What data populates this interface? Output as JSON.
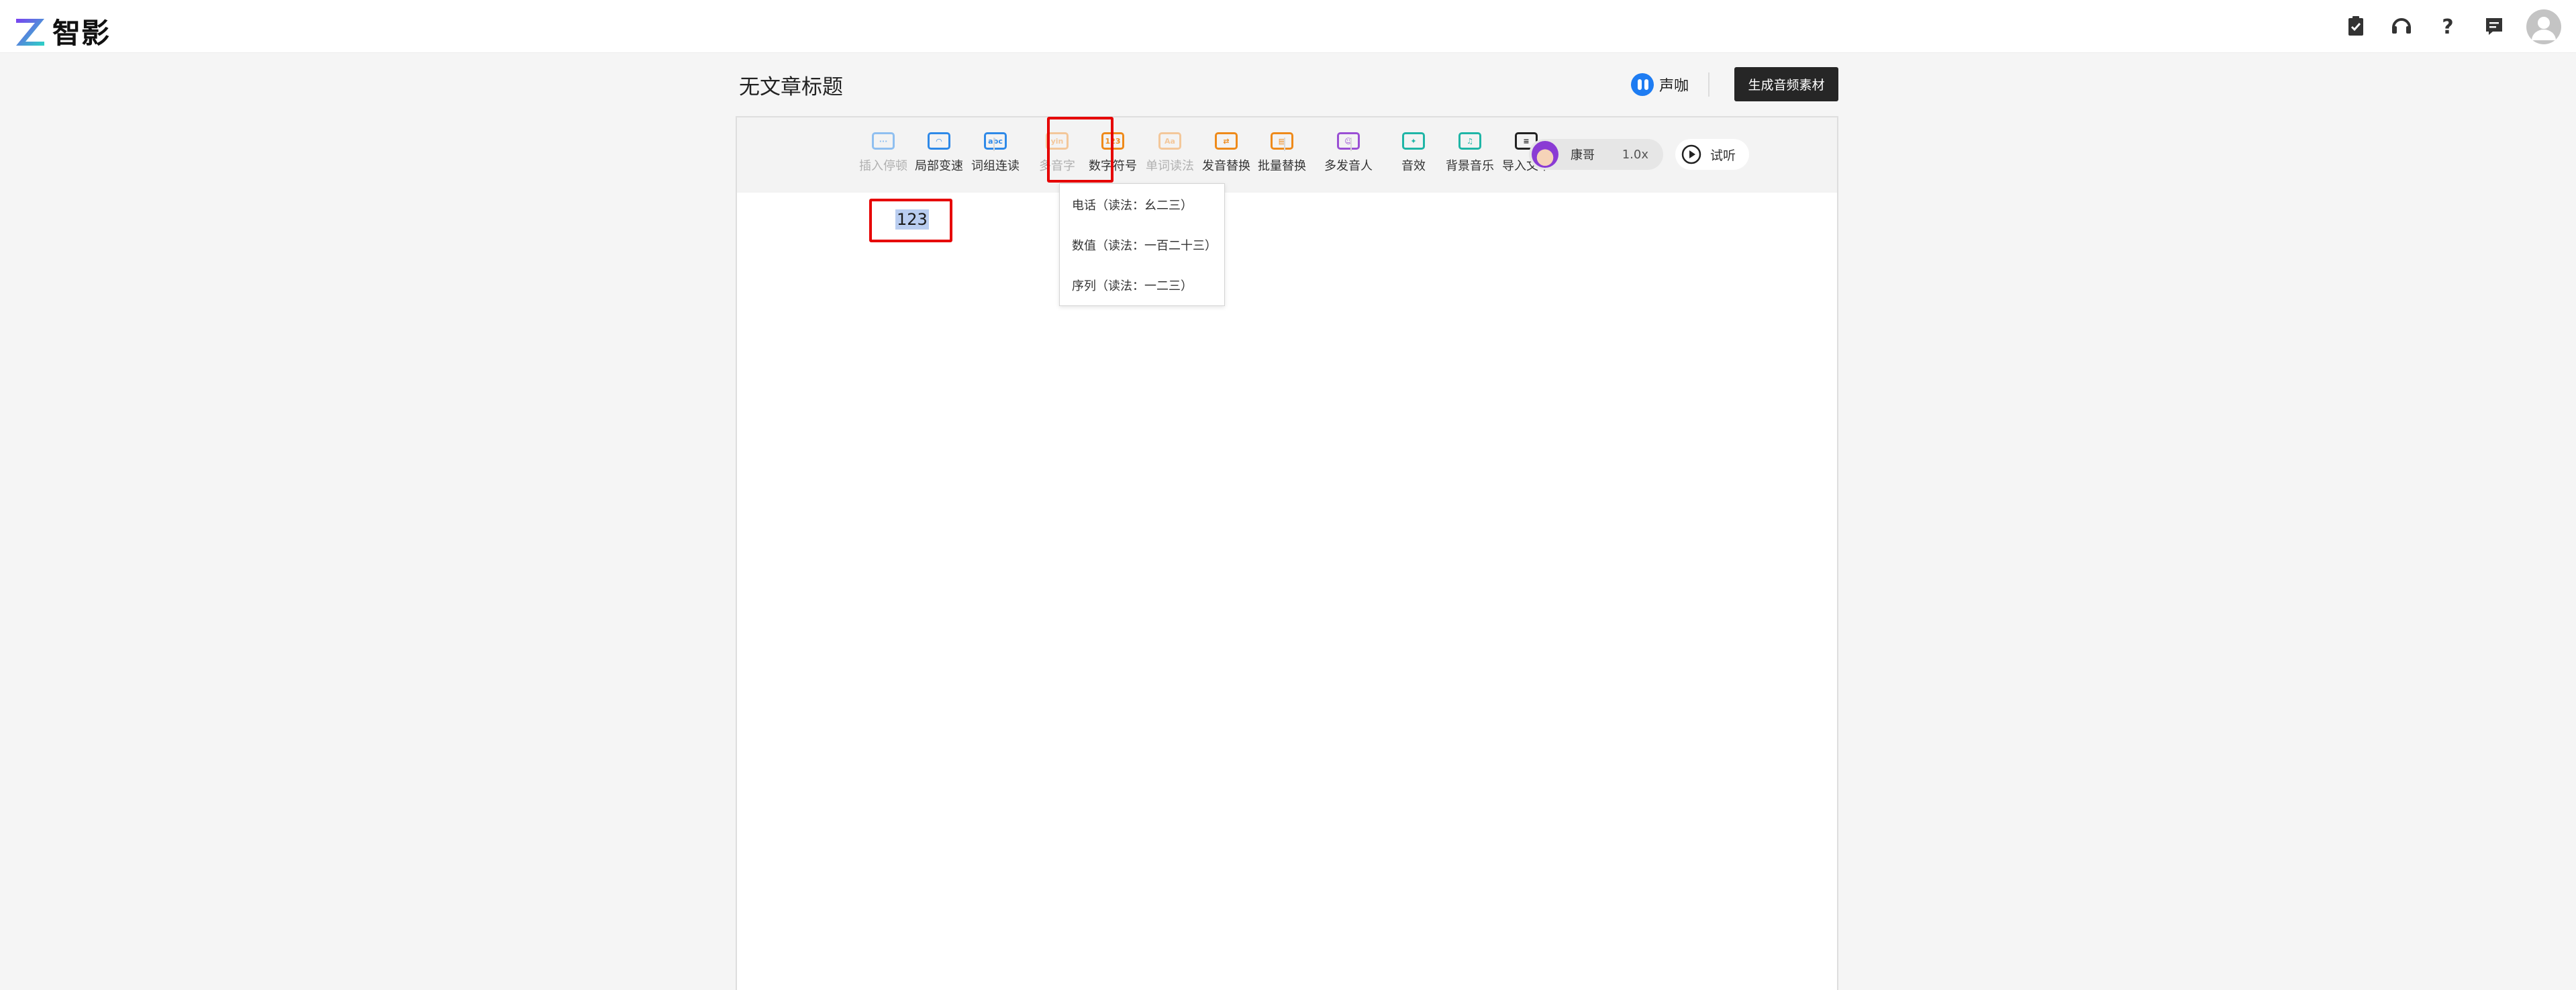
{
  "app": {
    "name": "智影"
  },
  "document": {
    "title": "无文章标题",
    "content_text": "123"
  },
  "header_actions": {
    "voice_label": "声咖",
    "generate_label": "生成音频素材"
  },
  "toolbar": {
    "tools": [
      {
        "label": "插入停顿",
        "icon": "pause-insert-icon",
        "color": "#8fbff0",
        "disabled": true
      },
      {
        "label": "局部变速",
        "icon": "speed-gauge-icon",
        "color": "#2e89e8",
        "disabled": false
      },
      {
        "label": "词组连读",
        "icon": "abc-link-icon",
        "color": "#2e89e8",
        "disabled": false
      },
      {
        "label": "多音字",
        "icon": "polyphone-icon",
        "color": "#f3c79a",
        "disabled": true
      },
      {
        "label": "数字符号",
        "icon": "number-symbol-icon",
        "color": "#ee8a1a",
        "disabled": false
      },
      {
        "label": "单词读法",
        "icon": "word-reading-icon",
        "color": "#f3c79a",
        "disabled": true
      },
      {
        "label": "发音替换",
        "icon": "pronounce-replace-icon",
        "color": "#ee8a1a",
        "disabled": false
      },
      {
        "label": "批量替换",
        "icon": "batch-replace-icon",
        "color": "#ee8a1a",
        "disabled": false
      },
      {
        "label": "多发音人",
        "icon": "multi-speaker-icon",
        "color": "#9a4fd4",
        "disabled": false
      },
      {
        "label": "音效",
        "icon": "sound-effect-icon",
        "color": "#1fb5a6",
        "disabled": false
      },
      {
        "label": "背景音乐",
        "icon": "background-music-icon",
        "color": "#1fb5a6",
        "disabled": false
      },
      {
        "label": "导入文本",
        "icon": "import-text-icon",
        "color": "#222222",
        "disabled": false
      }
    ],
    "voice": {
      "name": "康哥",
      "speed": "1.0x"
    },
    "listen_label": "试听"
  },
  "number_menu": {
    "items": [
      {
        "label": "电话（读法：幺二三）"
      },
      {
        "label": "数值（读法：一百二十三）"
      },
      {
        "label": "序列（读法：一二三）"
      }
    ]
  },
  "top_icons": [
    "task-clipboard-icon",
    "headset-icon",
    "help-icon",
    "message-icon"
  ]
}
